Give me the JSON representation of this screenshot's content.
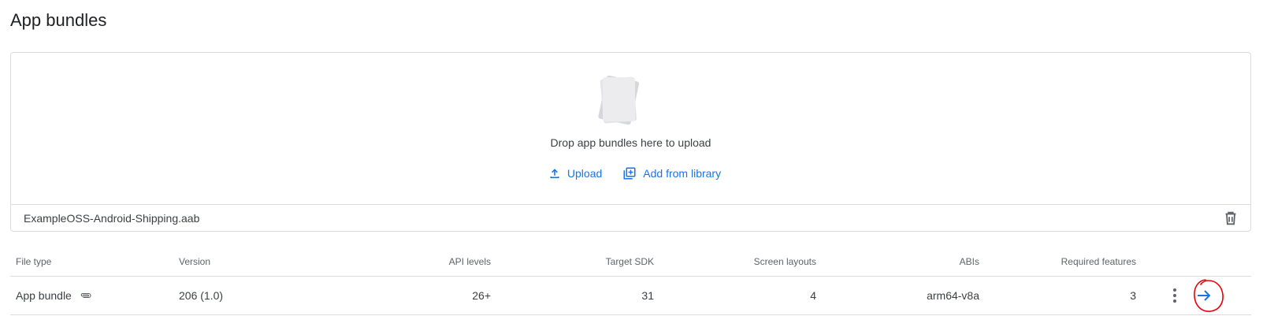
{
  "page": {
    "title": "App bundles"
  },
  "upload": {
    "drop_text": "Drop app bundles here to upload",
    "upload_label": "Upload",
    "add_from_library_label": "Add from library",
    "file_name": "ExampleOSS-Android-Shipping.aab"
  },
  "table": {
    "headers": {
      "file_type": "File type",
      "version": "Version",
      "api_levels": "API levels",
      "target_sdk": "Target SDK",
      "screen_layouts": "Screen layouts",
      "abis": "ABIs",
      "required_features": "Required features"
    },
    "rows": [
      {
        "file_type": "App bundle",
        "version": "206 (1.0)",
        "api_levels": "26+",
        "target_sdk": "31",
        "screen_layouts": "4",
        "abis": "arm64-v8a",
        "required_features": "3"
      }
    ]
  },
  "icons": {
    "upload": "upload-icon",
    "library": "add-library-icon",
    "delete": "trash-icon",
    "attachment": "paperclip-icon",
    "more": "more-vert-icon",
    "details": "arrow-forward-icon"
  },
  "colors": {
    "accent": "#1a73e8",
    "annotation": "#e8000a",
    "border": "#dadce0"
  }
}
